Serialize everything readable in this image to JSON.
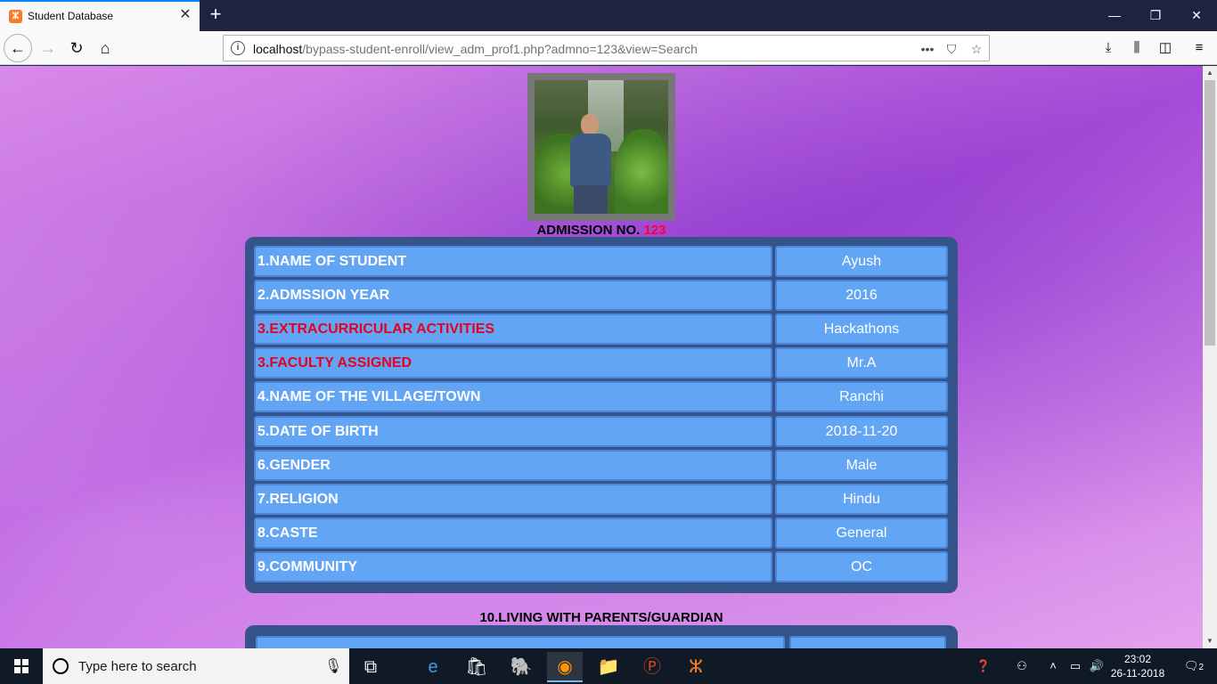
{
  "browser": {
    "tab_title": "Student Database",
    "tab_close": "✕",
    "new_tab": "+",
    "url_host": "localhost",
    "url_path": "/bypass-student-enroll/view_adm_prof1.php?admno=123&view=Search",
    "window_minimize": "—",
    "window_restore": "❐",
    "window_close": "✕"
  },
  "page": {
    "admission_label": "ADMISSION NO.",
    "admission_no": "123",
    "rows": [
      {
        "label": "1.NAME OF STUDENT",
        "value": "Ayush",
        "highlight": false
      },
      {
        "label": "2.ADMSSION YEAR",
        "value": "2016",
        "highlight": false
      },
      {
        "label": "3.EXTRACURRICULAR ACTIVITIES",
        "value": "Hackathons",
        "highlight": true
      },
      {
        "label": "3.FACULTY ASSIGNED",
        "value": "Mr.A",
        "highlight": true
      },
      {
        "label": "4.NAME OF THE VILLAGE/TOWN",
        "value": "Ranchi",
        "highlight": false
      },
      {
        "label": "5.DATE OF BIRTH",
        "value": "2018-11-20",
        "highlight": false
      },
      {
        "label": "6.GENDER",
        "value": "Male",
        "highlight": false
      },
      {
        "label": "7.RELIGION",
        "value": "Hindu",
        "highlight": false
      },
      {
        "label": "8.CASTE",
        "value": "General",
        "highlight": false
      },
      {
        "label": "9.COMMUNITY",
        "value": "OC",
        "highlight": false
      }
    ],
    "section2_title": "10.LIVING WITH PARENTS/GUARDIAN"
  },
  "taskbar": {
    "search_placeholder": "Type here to search",
    "time": "23:02",
    "date": "26-11-2018",
    "notification_count": "2"
  },
  "colors": {
    "label_cell": "#63a5f5",
    "table_bg": "#35558a",
    "highlight_text": "#e8001f",
    "admission_value": "#ff0033"
  }
}
